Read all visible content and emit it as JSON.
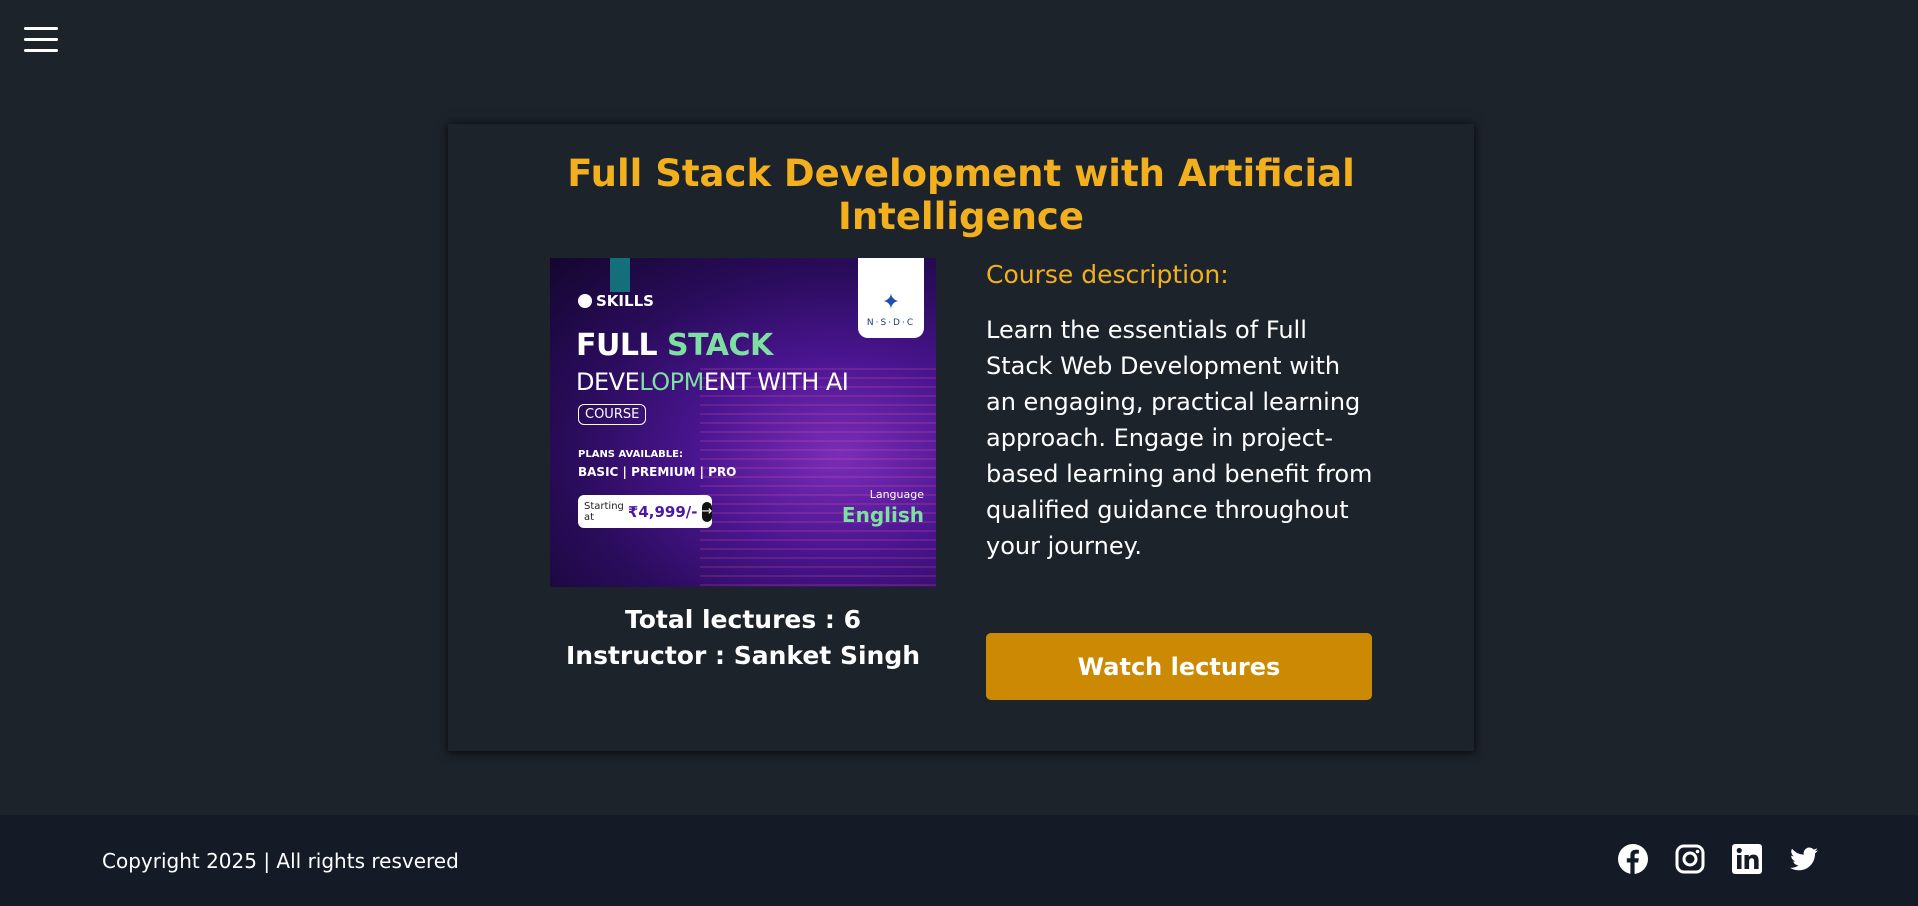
{
  "header": {
    "menu_icon": "hamburger-menu-icon"
  },
  "course": {
    "title": "Full Stack Development with Artificial Intelligence",
    "total_lectures_text": "Total lectures : 6",
    "instructor_text": "Instructor : Sanket Singh",
    "description_label": "Course description:",
    "description": "Learn the essentials of Full Stack Web Development with an engaging, practical learning approach. Engage in project-based learning and benefit from qualified guidance throughout your journey.",
    "watch_button_label": "Watch lectures"
  },
  "thumbnail": {
    "brand": "SKILLS",
    "line1_a": "FULL ",
    "line1_b": "STACK",
    "line2_a": "DEVE",
    "line2_b": "LOPM",
    "line2_c": "ENT WITH AI",
    "pill": "COURSE",
    "plans_label": "PLANS AVAILABLE:",
    "plans": "BASIC | PREMIUM | PRO",
    "starting_at": "Starting at",
    "price": "₹4,999/-",
    "partner_logo": "N·S·D·C",
    "language_label": "Language",
    "language": "English"
  },
  "footer": {
    "copyright": "Copyright 2025 | All rights resvered",
    "socials": [
      "facebook-icon",
      "instagram-icon",
      "linkedin-icon",
      "twitter-icon"
    ]
  },
  "colors": {
    "background": "#1d232a",
    "accent": "#f2b01e",
    "button": "#cc8a04",
    "footer": "#141a26"
  }
}
